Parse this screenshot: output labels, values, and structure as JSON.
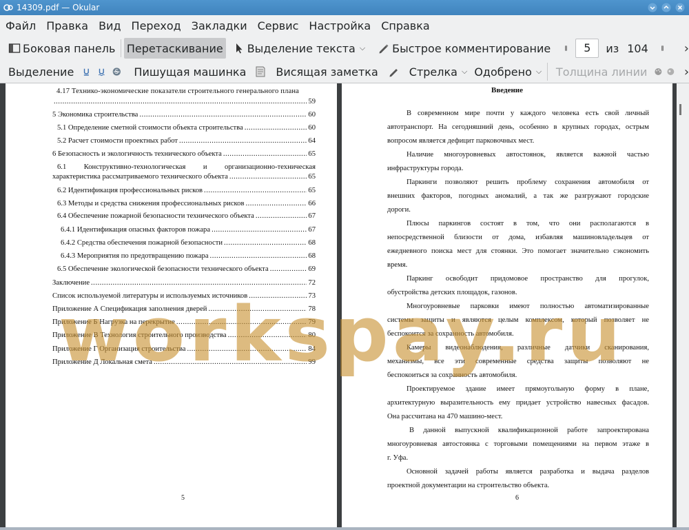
{
  "window": {
    "title": "14309.pdf  — Okular"
  },
  "menu": [
    "Файл",
    "Правка",
    "Вид",
    "Переход",
    "Закладки",
    "Сервис",
    "Настройка",
    "Справка"
  ],
  "toolbar1": {
    "sidebar": "Боковая панель",
    "drag": "Перетаскивание",
    "text_select": "Выделение текста",
    "quick_comment": "Быстрое комментирование",
    "page_current": "5",
    "page_of": "из",
    "page_total": "104"
  },
  "toolbar2": {
    "highlight": "Выделение",
    "typewriter": "Пишущая машинка",
    "sticky_note": "Висящая заметка",
    "arrow": "Стрелка",
    "stamp": "Одобрено",
    "line_width": "Толщина линии"
  },
  "left_page": {
    "toc": [
      {
        "text": "4.17 Технико-экономические показатели строительного генерального плана",
        "page": ""
      },
      {
        "text": "",
        "page": "59"
      },
      {
        "text": "5 Экономика строительства",
        "page": "60"
      },
      {
        "text": "5.1 Определение сметной стоимости объекта строительства",
        "page": "60"
      },
      {
        "text": "5.2 Расчет стоимости проектных работ",
        "page": "64"
      },
      {
        "text": "6 Безопасность и экологичность технического объекта",
        "page": "65"
      },
      {
        "text": "6.1 Конструктивно-технологическая и организационно-техническая",
        "page": ""
      },
      {
        "text": "характеристика рассматриваемого технического объекта",
        "page": "65"
      },
      {
        "text": "6.2 Идентификация профессиональных рисков",
        "page": "65"
      },
      {
        "text": "6.3 Методы и средства снижения профессиональных рисков",
        "page": "66"
      },
      {
        "text": "6.4 Обеспечение пожарной безопасности технического объекта",
        "page": "67"
      },
      {
        "text": "6.4.1 Идентификация опасных факторов пожара",
        "page": "67"
      },
      {
        "text": "6.4.2 Средства обеспечения пожарной безопасности",
        "page": "68"
      },
      {
        "text": "6.4.3 Мероприятия по предотвращению пожара",
        "page": "68"
      },
      {
        "text": "6.5 Обеспечение экологической безопасности технического объекта",
        "page": "69"
      },
      {
        "text": "Заключение",
        "page": "72"
      },
      {
        "text": "Список используемой литературы и используемых источников",
        "page": "73"
      },
      {
        "text": "Приложение А Спецификация заполнения дверей",
        "page": "78"
      },
      {
        "text": "Приложение Б Нагрузка на перекрытие",
        "page": "79"
      },
      {
        "text": "Приложение В Технология строительного производства",
        "page": "80"
      },
      {
        "text": "Приложение Г Организация строительства",
        "page": "84"
      },
      {
        "text": "Приложение Д Локальная смета",
        "page": "99"
      }
    ],
    "page_number": "5"
  },
  "right_page": {
    "heading": "Введение",
    "lines": [
      "В современном мире почти у каждого человека есть свой личный",
      "автотранспорт. На сегодняшний день, особенно в крупных городах, острым",
      "вопросом является дефицит парковочных мест.",
      "Наличие многоуровневых автостоянок, является важной частью",
      "инфраструктуры города.",
      "Паркинги позволяют решить проблему сохранения автомобиля от",
      "внешних факторов, погодных аномалий, а так же разгружают городские",
      "дороги.",
      "Плюсы паркингов состоят в том, что они располагаются в",
      "непосредственной близости от дома, избавляя машиновладельцев от",
      "ежедневного поиска мест для стоянки. Это помогает значительно сэкономить",
      "время.",
      "Паркинг освободит придомовое пространство для прогулок,",
      "обустройства детских площадок, газонов.",
      "Многоуровневые парковки имеют полностью автоматизированные",
      "системы защиты и являются целым комплексом, который позволяет не",
      "беспокоится за сохранность автомобиля.",
      "Камеры видеонаблюдения, различные датчики сканирования,",
      "механизмы, все эти современные средства защиты позволяют не",
      "беспокоиться за сохранность автомобиля.",
      "Проектируемое здание имеет прямоугольную форму в плане,",
      "архитектурную выразительность ему придает устройство навесных фасадов.",
      "Она рассчитана на  470 машино-мест.",
      "В данной выпускной квалификационной работе запроектирована",
      "многоуровневая автостоянка с торговыми помещениями на первом этаже в",
      "г. Уфа.",
      "Основной задачей работы является разработка и выдача разделов",
      "проектной документации на строительство объекта."
    ],
    "page_number": "6"
  },
  "watermark": "workspay.ru",
  "colors": {
    "titlebar": "#4589c4",
    "toolbar_bg": "#eff0f1",
    "active_button": "#c9cacc",
    "watermark": "#c89132"
  }
}
